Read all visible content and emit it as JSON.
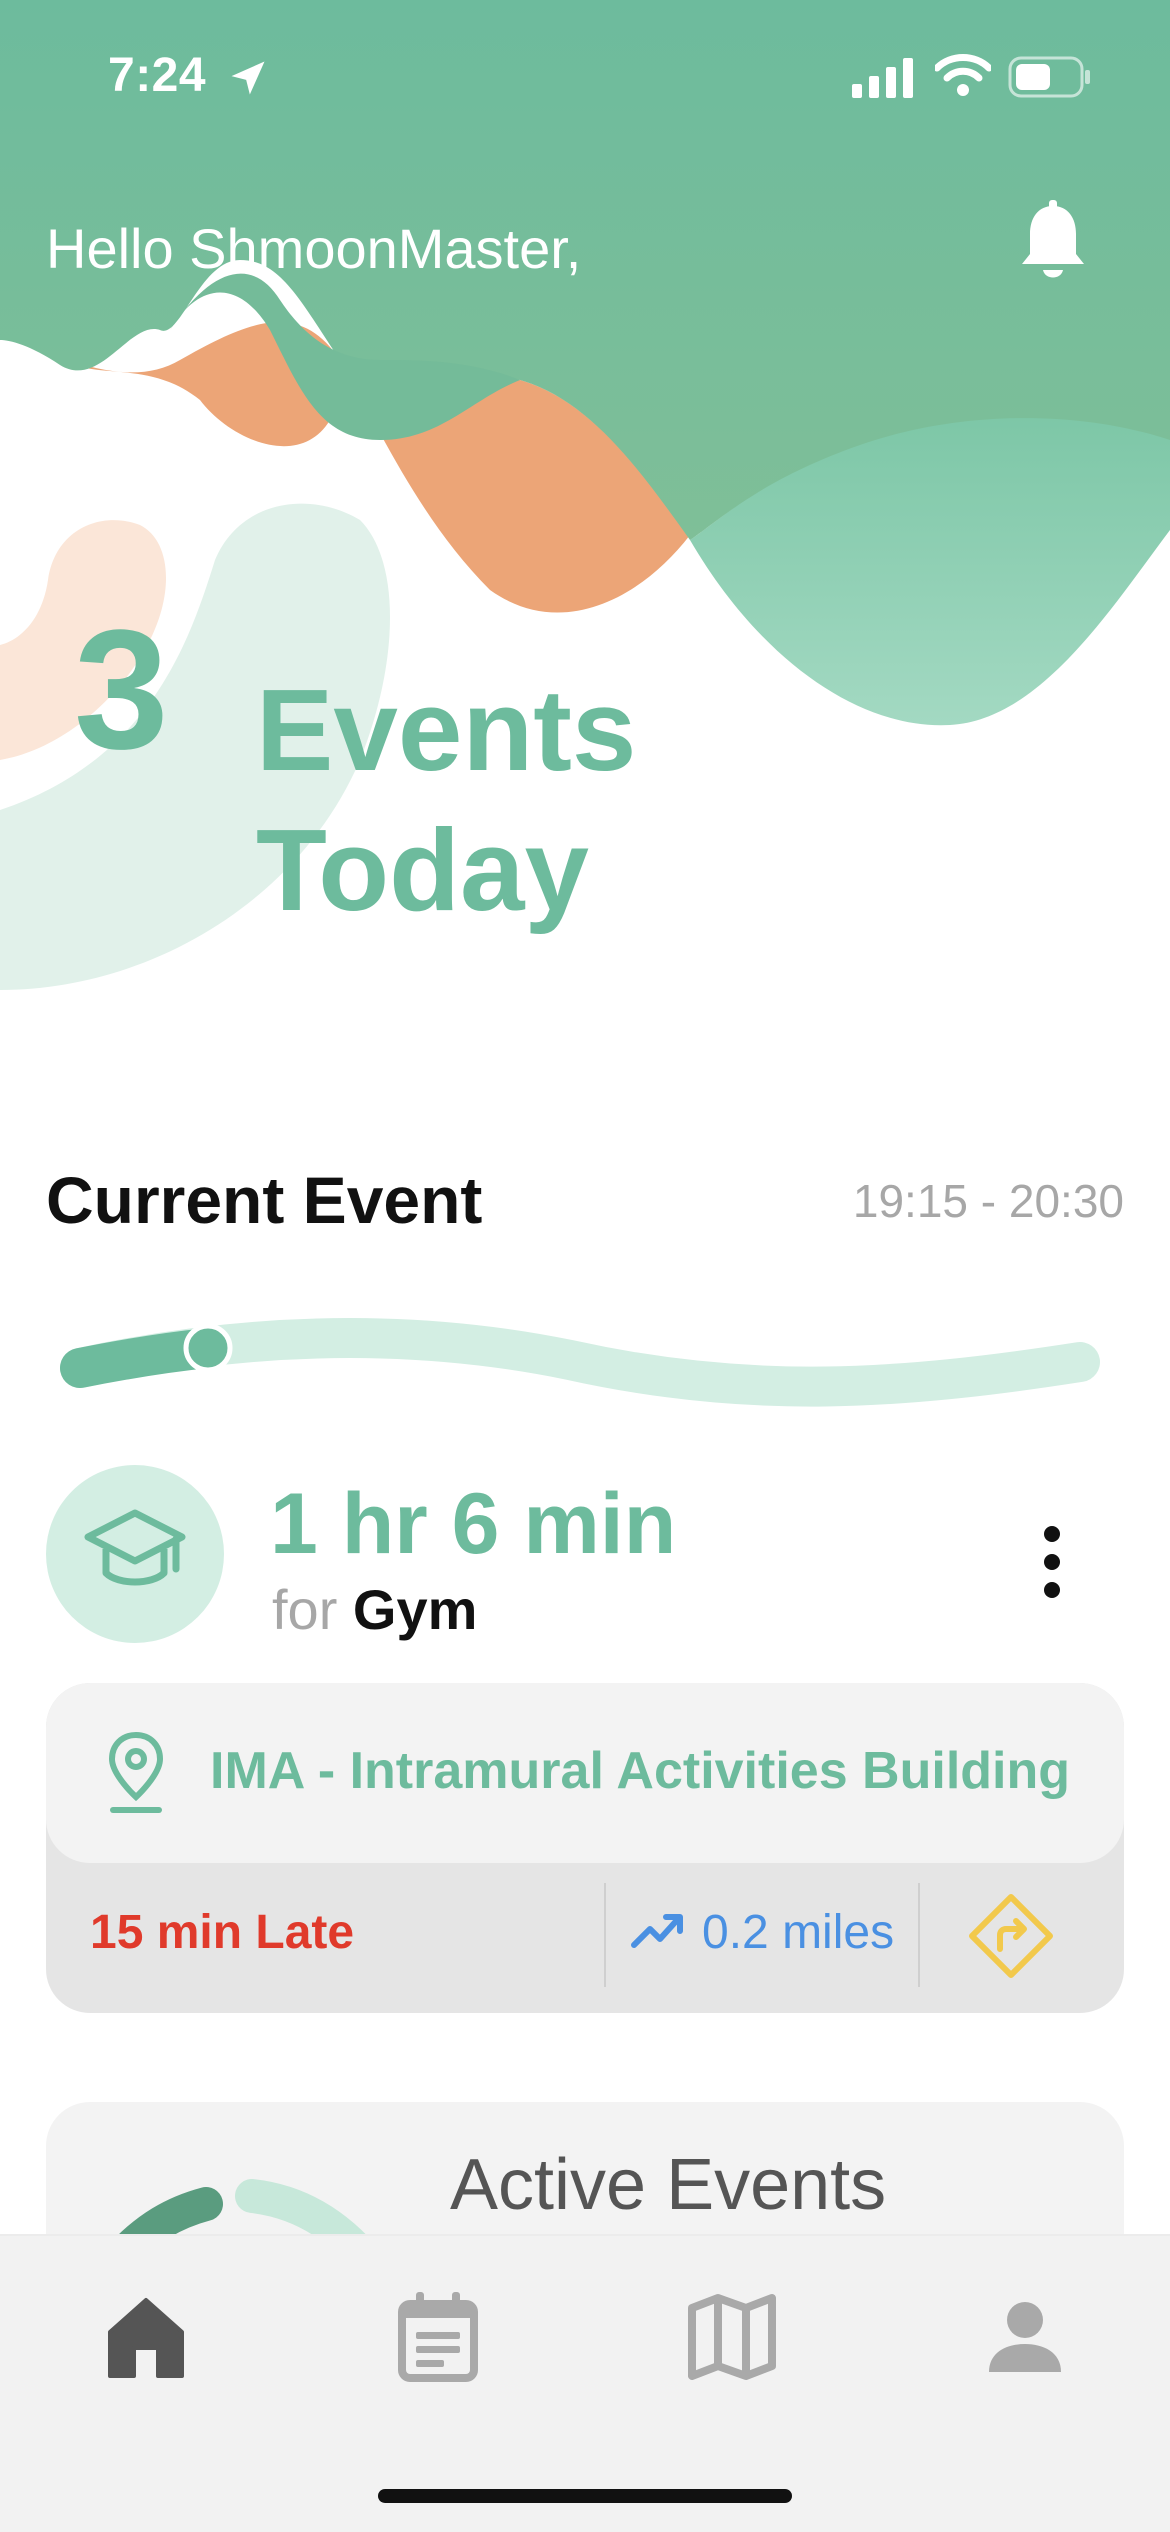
{
  "status_bar": {
    "time": "7:24"
  },
  "header": {
    "greeting": "Hello ShmoonMaster,"
  },
  "summary": {
    "events_count": "3",
    "events_label": "Events Today"
  },
  "current_event": {
    "section_title": "Current Event",
    "time_range": "19:15 - 20:30",
    "progress_fraction": 0.13,
    "duration": "1 hr 6 min",
    "for_label": "for",
    "event_name": "Gym",
    "location": "IMA - Intramural Activities Building",
    "late_status": "15 min Late",
    "distance": "0.2 miles"
  },
  "active_events": {
    "title": "Active Events"
  },
  "icons": {
    "location_arrow": "location-arrow-icon",
    "signal": "cellular-signal-icon",
    "wifi": "wifi-icon",
    "battery": "battery-icon",
    "bell": "bell-icon",
    "event_type": "graduation-cap-icon",
    "more": "more-vertical-icon",
    "pin": "map-pin-icon",
    "trend": "trending-up-icon",
    "directions": "directions-icon",
    "tabs": [
      "home-icon",
      "calendar-list-icon",
      "map-icon",
      "profile-icon"
    ]
  },
  "colors": {
    "primary_green": "#6dbb9d",
    "light_green": "#d3eee3",
    "orange": "#eca577",
    "late_red": "#e03a2b",
    "distance_blue": "#4a90e2",
    "directions_yellow": "#f2c94c"
  }
}
